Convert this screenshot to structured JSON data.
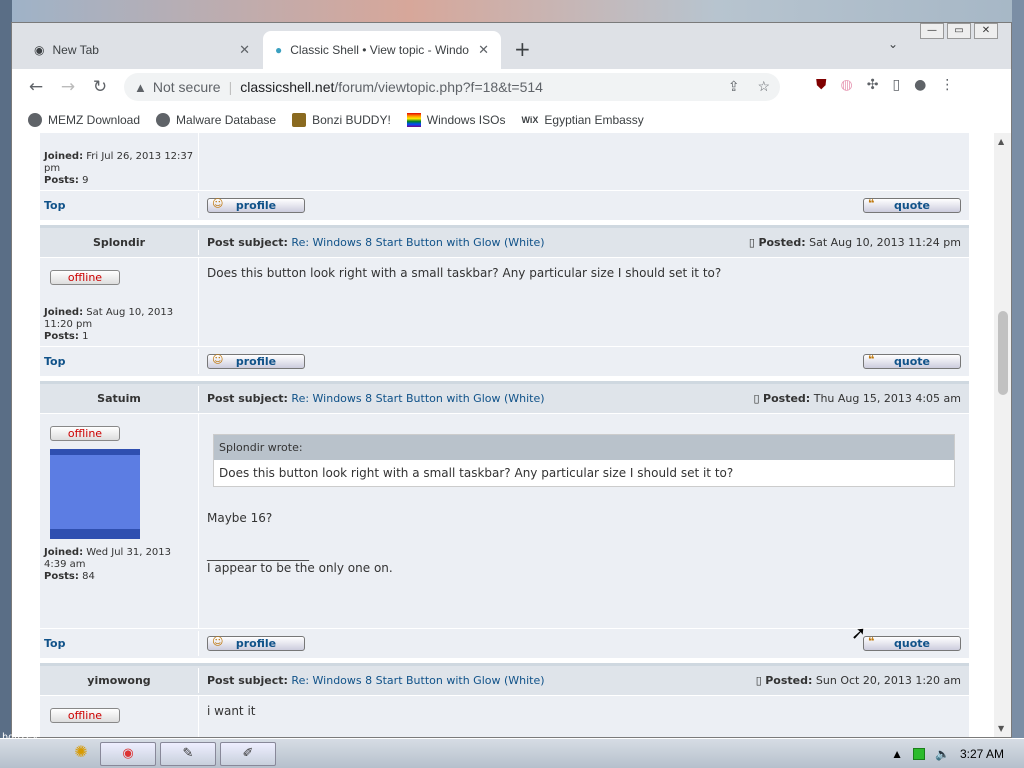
{
  "browser": {
    "tabs": [
      {
        "title": "New Tab",
        "active": false
      },
      {
        "title": "Classic Shell • View topic - Windo",
        "active": true
      }
    ],
    "url_security": "Not secure",
    "url_host": "classicshell.net",
    "url_path": "/forum/viewtopic.php?f=18&t=514",
    "bookmarks": [
      "MEMZ Download",
      "Malware Database",
      "Bonzi BUDDY!",
      "Windows ISOs",
      "Egyptian Embassy"
    ],
    "bookmark_icons": [
      "globe-icon",
      "globe-icon",
      "bonzi-icon",
      "rainbow-flag-icon",
      "wix-icon"
    ]
  },
  "forum": {
    "top_partial": {
      "joined_label": "Joined:",
      "joined_value": "Fri Jul 26, 2013 12:37 pm",
      "posts_label": "Posts:",
      "posts_value": "9",
      "top_link": "Top",
      "profile_label": "profile",
      "quote_label": "quote"
    },
    "posts": [
      {
        "author": "Splondir",
        "subject_label": "Post subject:",
        "subject": "Re: Windows 8 Start Button with Glow (White)",
        "posted_label": "Posted:",
        "posted": "Sat Aug 10, 2013 11:24 pm",
        "status": "offline",
        "joined_label": "Joined:",
        "joined": "Sat Aug 10, 2013 11:20 pm",
        "posts_label": "Posts:",
        "posts": "1",
        "body": "Does this button look right with a small taskbar? Any particular size I should set it to?",
        "top_link": "Top",
        "profile_label": "profile",
        "quote_label": "quote"
      },
      {
        "author": "Satuim",
        "subject_label": "Post subject:",
        "subject": "Re: Windows 8 Start Button with Glow (White)",
        "posted_label": "Posted:",
        "posted": "Thu Aug 15, 2013 4:05 am",
        "status": "offline",
        "quote_author": "Splondir wrote:",
        "quote_text": "Does this button look right with a small taskbar? Any particular size I should set it to?",
        "body": "Maybe 16?",
        "signature_line": "_________________",
        "signature": "I appear to be the only one on.",
        "joined_label": "Joined:",
        "joined": "Wed Jul 31, 2013 4:39 am",
        "posts_label": "Posts:",
        "posts": "84",
        "top_link": "Top",
        "profile_label": "profile",
        "quote_label": "quote"
      },
      {
        "author": "yimowong",
        "subject_label": "Post subject:",
        "subject": "Re: Windows 8 Start Button with Glow (White)",
        "posted_label": "Posted:",
        "posted": "Sun Oct 20, 2013 1:20 am",
        "status": "offline",
        "body": "i want it"
      }
    ]
  },
  "desktop": {
    "corner_text": "bonzey\nanety"
  },
  "taskbar": {
    "clock": "3:27 AM"
  }
}
